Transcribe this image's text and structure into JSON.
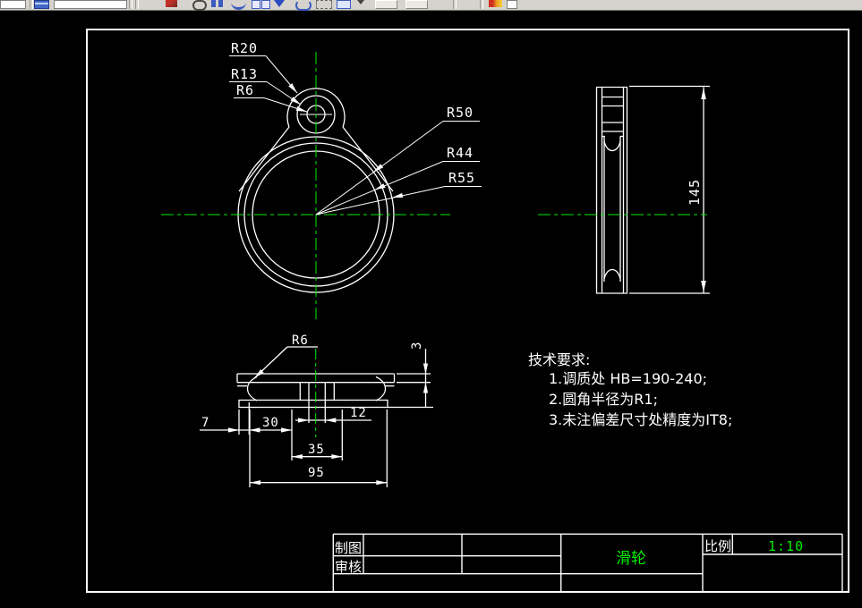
{
  "toolbar": {
    "icon_names": [
      "table-icon",
      "command-input",
      "pencil-icon",
      "eraser-icon",
      "columns-icon",
      "arc-tool-icon",
      "blocks-icon",
      "down-arrow-icon",
      "rotate-icon",
      "selection-box-icon",
      "panel-icon",
      "chevron-icon",
      "palette-icon"
    ],
    "command_input_value": ""
  },
  "drawing": {
    "front_view": {
      "radius_labels": {
        "r20": "R20",
        "r13": "R13",
        "r6": "R6",
        "r50": "R50",
        "r44": "R44",
        "r55": "R55"
      }
    },
    "side_view": {
      "height": "145"
    },
    "section_view": {
      "fillet": "R6",
      "thickness": "3",
      "d7": "7",
      "d30": "30",
      "d12": "12",
      "d35": "35",
      "d95": "95"
    },
    "tech_requirements": {
      "title": "技术要求:",
      "items": [
        "1.调质处  HB=190-240;",
        "2.圆角半径为R1;",
        "3.未注偏差尺寸处精度为IT8;"
      ]
    },
    "title_block": {
      "drafter_label": "制图",
      "checker_label": "审核",
      "part_name": "滑轮",
      "scale_label": "比例",
      "scale_value": "1:10"
    }
  },
  "colors": {
    "background": "#000000",
    "line": "#ffffff",
    "centerline": "#00ee00",
    "highlight_text": "#00ee00",
    "toolbar_bg": "#d6d3ce"
  }
}
